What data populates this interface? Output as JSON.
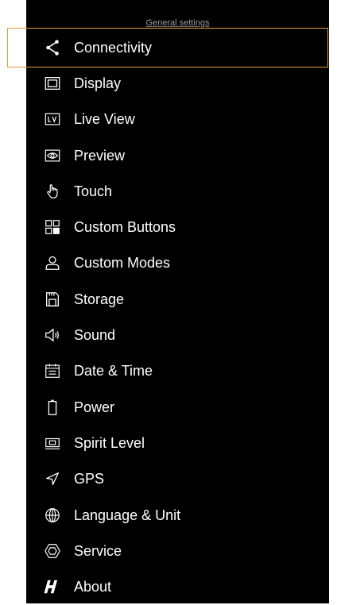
{
  "header": {
    "title": "General settings"
  },
  "menu": {
    "items": [
      {
        "label": "Connectivity",
        "icon": "share-icon"
      },
      {
        "label": "Display",
        "icon": "display-icon"
      },
      {
        "label": "Live View",
        "icon": "live-view-icon"
      },
      {
        "label": "Preview",
        "icon": "eye-icon"
      },
      {
        "label": "Touch",
        "icon": "touch-hand-icon"
      },
      {
        "label": "Custom Buttons",
        "icon": "custom-buttons-icon"
      },
      {
        "label": "Custom Modes",
        "icon": "user-icon"
      },
      {
        "label": "Storage",
        "icon": "sd-card-icon"
      },
      {
        "label": "Sound",
        "icon": "speaker-icon"
      },
      {
        "label": "Date & Time",
        "icon": "calendar-icon"
      },
      {
        "label": "Power",
        "icon": "battery-icon"
      },
      {
        "label": "Spirit Level",
        "icon": "level-icon"
      },
      {
        "label": "GPS",
        "icon": "location-arrow-icon"
      },
      {
        "label": "Language & Unit",
        "icon": "globe-icon"
      },
      {
        "label": "Service",
        "icon": "service-hex-icon"
      },
      {
        "label": "About",
        "icon": "brand-h-icon"
      }
    ],
    "selected_index": 0
  },
  "colors": {
    "background": "#000000",
    "text": "#ffffff",
    "header_text": "#9a9a9a",
    "highlight_border": "#e39a3b"
  }
}
